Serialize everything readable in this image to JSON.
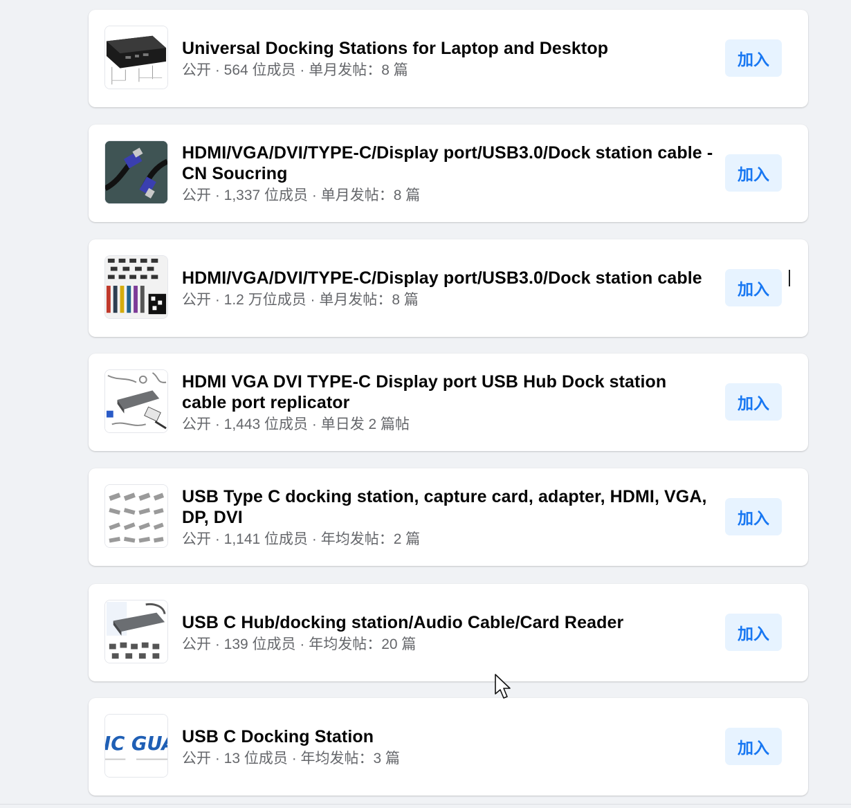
{
  "join_label": "加入",
  "groups": [
    {
      "title": "Universal Docking Stations for Laptop and Desktop",
      "meta": "公开 · 564 位成员 · 单月发帖：8 篇"
    },
    {
      "title": "HDMI/VGA/DVI/TYPE-C/Display port/USB3.0/Dock station cable - CN Soucring",
      "meta": "公开 · 1,337 位成员 · 单月发帖：8 篇"
    },
    {
      "title": "HDMI/VGA/DVI/TYPE-C/Display port/USB3.0/Dock station cable",
      "meta": "公开 · 1.2 万位成员 · 单月发帖：8 篇"
    },
    {
      "title": "HDMI VGA DVI TYPE-C Display port USB Hub Dock station cable port replicator",
      "meta": "公开 · 1,443 位成员 · 单日发 2 篇帖"
    },
    {
      "title": "USB Type C docking station, capture card, adapter, HDMI, VGA, DP, DVI",
      "meta": "公开 · 1,141 位成员 · 年均发帖：2 篇"
    },
    {
      "title": "USB C Hub/docking station/Audio Cable/Card Reader",
      "meta": "公开 · 139 位成员 · 年均发帖：20 篇"
    },
    {
      "title": "USB C Docking Station",
      "meta": "公开 · 13 位成员 · 年均发帖：3 篇",
      "logo_text": "IC GUA"
    }
  ],
  "colors": {
    "background": "#f0f2f5",
    "card": "#ffffff",
    "title": "#050505",
    "meta": "#65676b",
    "join_bg": "#e7f3ff",
    "join_text": "#1877f2"
  }
}
